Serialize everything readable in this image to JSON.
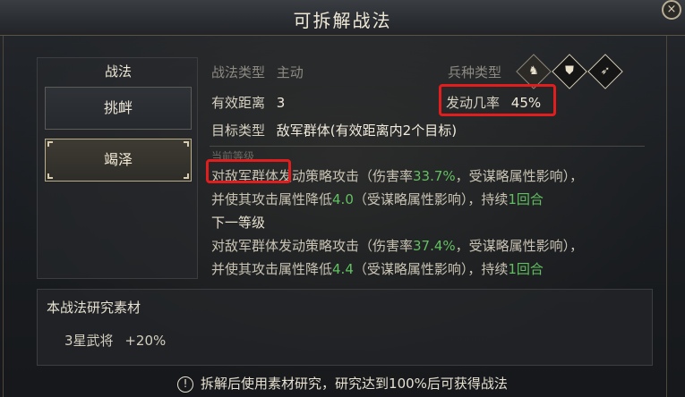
{
  "window": {
    "title": "可拆解战法",
    "close_icon": "×"
  },
  "skills": {
    "header": "战法",
    "items": [
      {
        "label": "挑衅",
        "selected": false
      },
      {
        "label": "竭泽",
        "selected": true
      }
    ]
  },
  "detail": {
    "type_label": "战法类型",
    "type_value": "主动",
    "troop_label": "兵种类型",
    "troop_icons": [
      "cavalry-icon",
      "shield-icon",
      "bow-icon"
    ],
    "range_label": "有效距离",
    "range_value": "3",
    "rate_label": "发动几率",
    "rate_value": "45%",
    "target_label": "目标类型",
    "target_value": "敌军群体(有效距离内2个目标)",
    "desc_hidden": "当前等级",
    "desc": {
      "line1_a": "对敌军群体发动策略攻击（伤害率",
      "line1_num": "33.7%",
      "line1_b": "，受谋略属性影响），",
      "line2_a": "并使其攻击属性降低",
      "line2_num": "4.0",
      "line2_b": "（受谋略属性影响），持续",
      "line2_num2": "1回合"
    },
    "next_level_label": "下一等级",
    "next": {
      "line1_a": "对敌军群体发动策略攻击（伤害率",
      "line1_num": "37.4%",
      "line1_b": "，受谋略属性影响），",
      "line2_a": "并使其攻击属性降低",
      "line2_num": "4.4",
      "line2_b": "（受谋略属性影响），持续",
      "line2_num2": "1回合"
    }
  },
  "materials": {
    "title": "本战法研究素材",
    "item_label": "3星武将",
    "item_bonus": "+20%"
  },
  "footer": {
    "warn_icon": "!",
    "text": "拆解后使用素材研究，研究达到100%后可获得战法"
  }
}
